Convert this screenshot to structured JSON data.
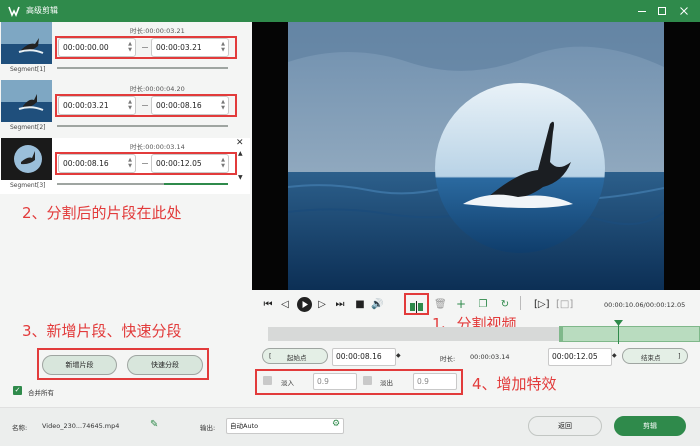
{
  "window": {
    "title": "高级剪辑"
  },
  "segments": [
    {
      "label": "Segment[1]",
      "duration_label": "时长:",
      "duration": "00:00:03.21",
      "start": "00:00:00.00",
      "end": "00:00:03.21"
    },
    {
      "label": "Segment[2]",
      "duration_label": "时长:",
      "duration": "00:00:04.20",
      "start": "00:00:03.21",
      "end": "00:00:08.16"
    },
    {
      "label": "Segment[3]",
      "duration_label": "时长:",
      "duration": "00:00:03.14",
      "start": "00:00:08.16",
      "end": "00:00:12.05"
    }
  ],
  "annotations": {
    "a1": "1、分割视频",
    "a2": "2、分割后的片段在此处",
    "a3": "3、新增片段、快速分段",
    "a4": "4、增加特效"
  },
  "left_buttons": {
    "new_segment": "新增片段",
    "fast_split": "快速分段"
  },
  "merge": {
    "label": "合并所有",
    "checked": true
  },
  "player": {
    "time_display": "00:00:10.06/00:00:12.05"
  },
  "range": {
    "start_label": "起始点",
    "start_value": "00:00:08.16",
    "duration_label": "时长:",
    "duration_value": "00:00:03.14",
    "end_value": "00:00:12.05",
    "end_label": "结束点"
  },
  "effects": {
    "fade_in_label": "淡入",
    "fade_in_value": "0.9",
    "fade_out_label": "淡出",
    "fade_out_value": "0.9"
  },
  "footer": {
    "name_label": "名称:",
    "name_value": "Video_230...74645.mp4",
    "output_label": "输出:",
    "output_value": "自动Auto",
    "back_button": "返回",
    "cut_button": "剪辑"
  },
  "colors": {
    "accent": "#2f8a4b",
    "annotation": "#e23b3b"
  }
}
